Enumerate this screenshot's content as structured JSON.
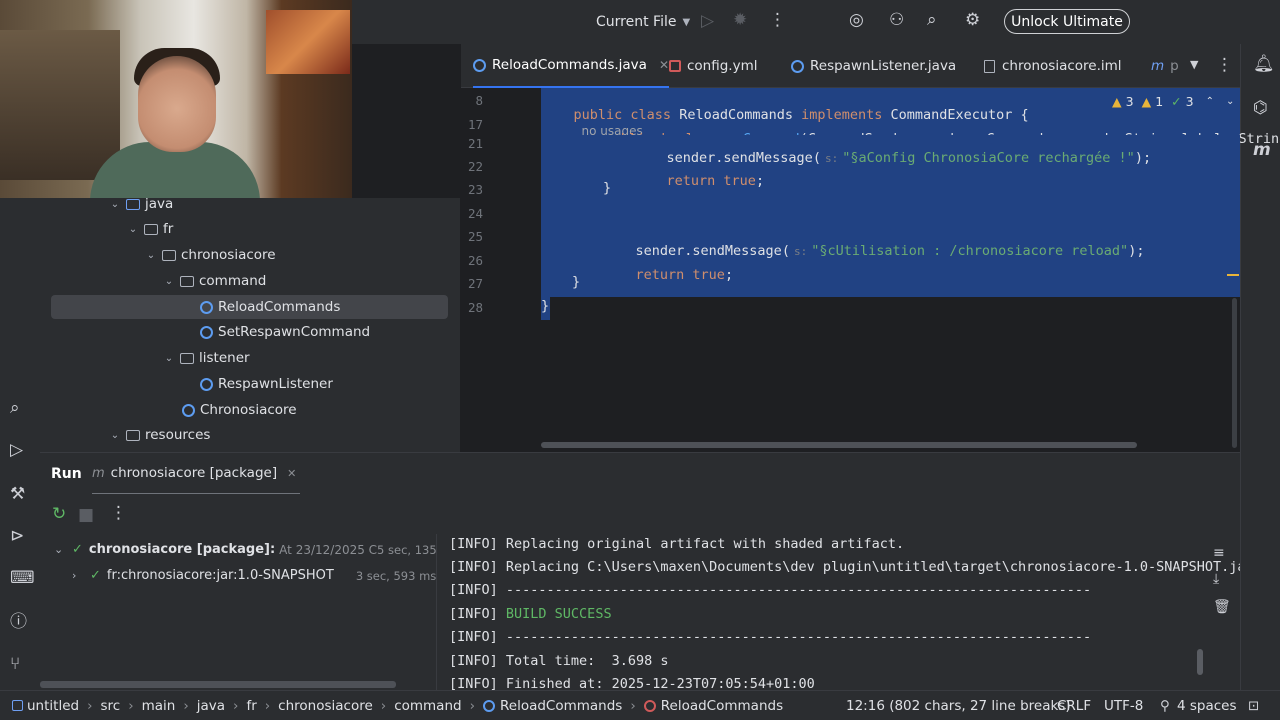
{
  "topbar": {
    "run_config": "Current File",
    "unlock_label": "Unlock Ultimate"
  },
  "tabs": [
    {
      "label": "ReloadCommands.java",
      "active": true
    },
    {
      "label": "config.yml"
    },
    {
      "label": "RespawnListener.java"
    },
    {
      "label": "chronosiacore.iml"
    },
    {
      "label": "p"
    }
  ],
  "project_tree": [
    {
      "label": "java"
    },
    {
      "label": "fr"
    },
    {
      "label": "chronosiacore"
    },
    {
      "label": "command"
    },
    {
      "label": "ReloadCommands",
      "selected": true
    },
    {
      "label": "SetRespawnCommand"
    },
    {
      "label": "listener"
    },
    {
      "label": "RespawnListener"
    },
    {
      "label": "Chronosiacore"
    },
    {
      "label": "resources"
    }
  ],
  "editor": {
    "line_numbers": [
      "8",
      "17",
      "21",
      "22",
      "23",
      "24",
      "25",
      "26",
      "27",
      "28"
    ],
    "sticky1_no_usages": "no usages",
    "inspection": {
      "warnings": "3",
      "weak_warnings": "1",
      "ok": "3"
    },
    "hint_s": "s:",
    "line8": {
      "a": "public class ",
      "b": "ReloadCommands ",
      "c": "implements ",
      "d": "CommandExecutor {"
    },
    "line17": {
      "a": "public boolean ",
      "b": "onCommand",
      "c": "(CommandSender sender, Command command, String label, String[]"
    },
    "line21": {
      "a": "sender.sendMessage(",
      "b": "\"§aConfig ChronosiaCore rechargée !\"",
      "c": ");"
    },
    "line22": {
      "a": "return ",
      "b": "true",
      "c": ";"
    },
    "line23": "}",
    "line25": {
      "a": "sender.sendMessage(",
      "b": "\"§cUtilisation : /chronosiacore reload\"",
      "c": ");"
    },
    "line26": {
      "a": "return ",
      "b": "true",
      "c": ";"
    },
    "line27": "}",
    "line28": "}"
  },
  "run_panel": {
    "run_tab": "Run",
    "config_tab": "chronosiacore [package]",
    "tree": [
      {
        "label": "chronosiacore [package]:",
        "detail": "At 23/12/2025 C",
        "time": "5 sec, 135 ms"
      },
      {
        "label": "fr:chronosiacore:jar:1.0-SNAPSHOT",
        "time": "3 sec, 593 ms"
      }
    ],
    "console": [
      {
        "tag": "[INFO]",
        "text": " Replacing original artifact with shaded artifact."
      },
      {
        "tag": "[INFO]",
        "text": " Replacing C:\\Users\\maxen\\Documents\\dev plugin\\untitled\\target\\chronosiacore-1.0-SNAPSHOT.ja"
      },
      {
        "tag": "[INFO]",
        "text": " ------------------------------------------------------------------------"
      },
      {
        "tag": "[INFO]",
        "text": " BUILD SUCCESS",
        "success": true
      },
      {
        "tag": "[INFO]",
        "text": " ------------------------------------------------------------------------"
      },
      {
        "tag": "[INFO]",
        "text": " Total time:  3.698 s"
      },
      {
        "tag": "[INFO]",
        "text": " Finished at: 2025-12-23T07:05:54+01:00"
      }
    ]
  },
  "statusbar": {
    "breadcrumbs": [
      "untitled",
      "src",
      "main",
      "java",
      "fr",
      "chronosiacore",
      "command",
      "ReloadCommands",
      "ReloadCommands"
    ],
    "position": "12:16 (802 chars, 27 line breaks)",
    "line_sep": "CRLF",
    "encoding": "UTF-8",
    "indent": "4 spaces"
  }
}
